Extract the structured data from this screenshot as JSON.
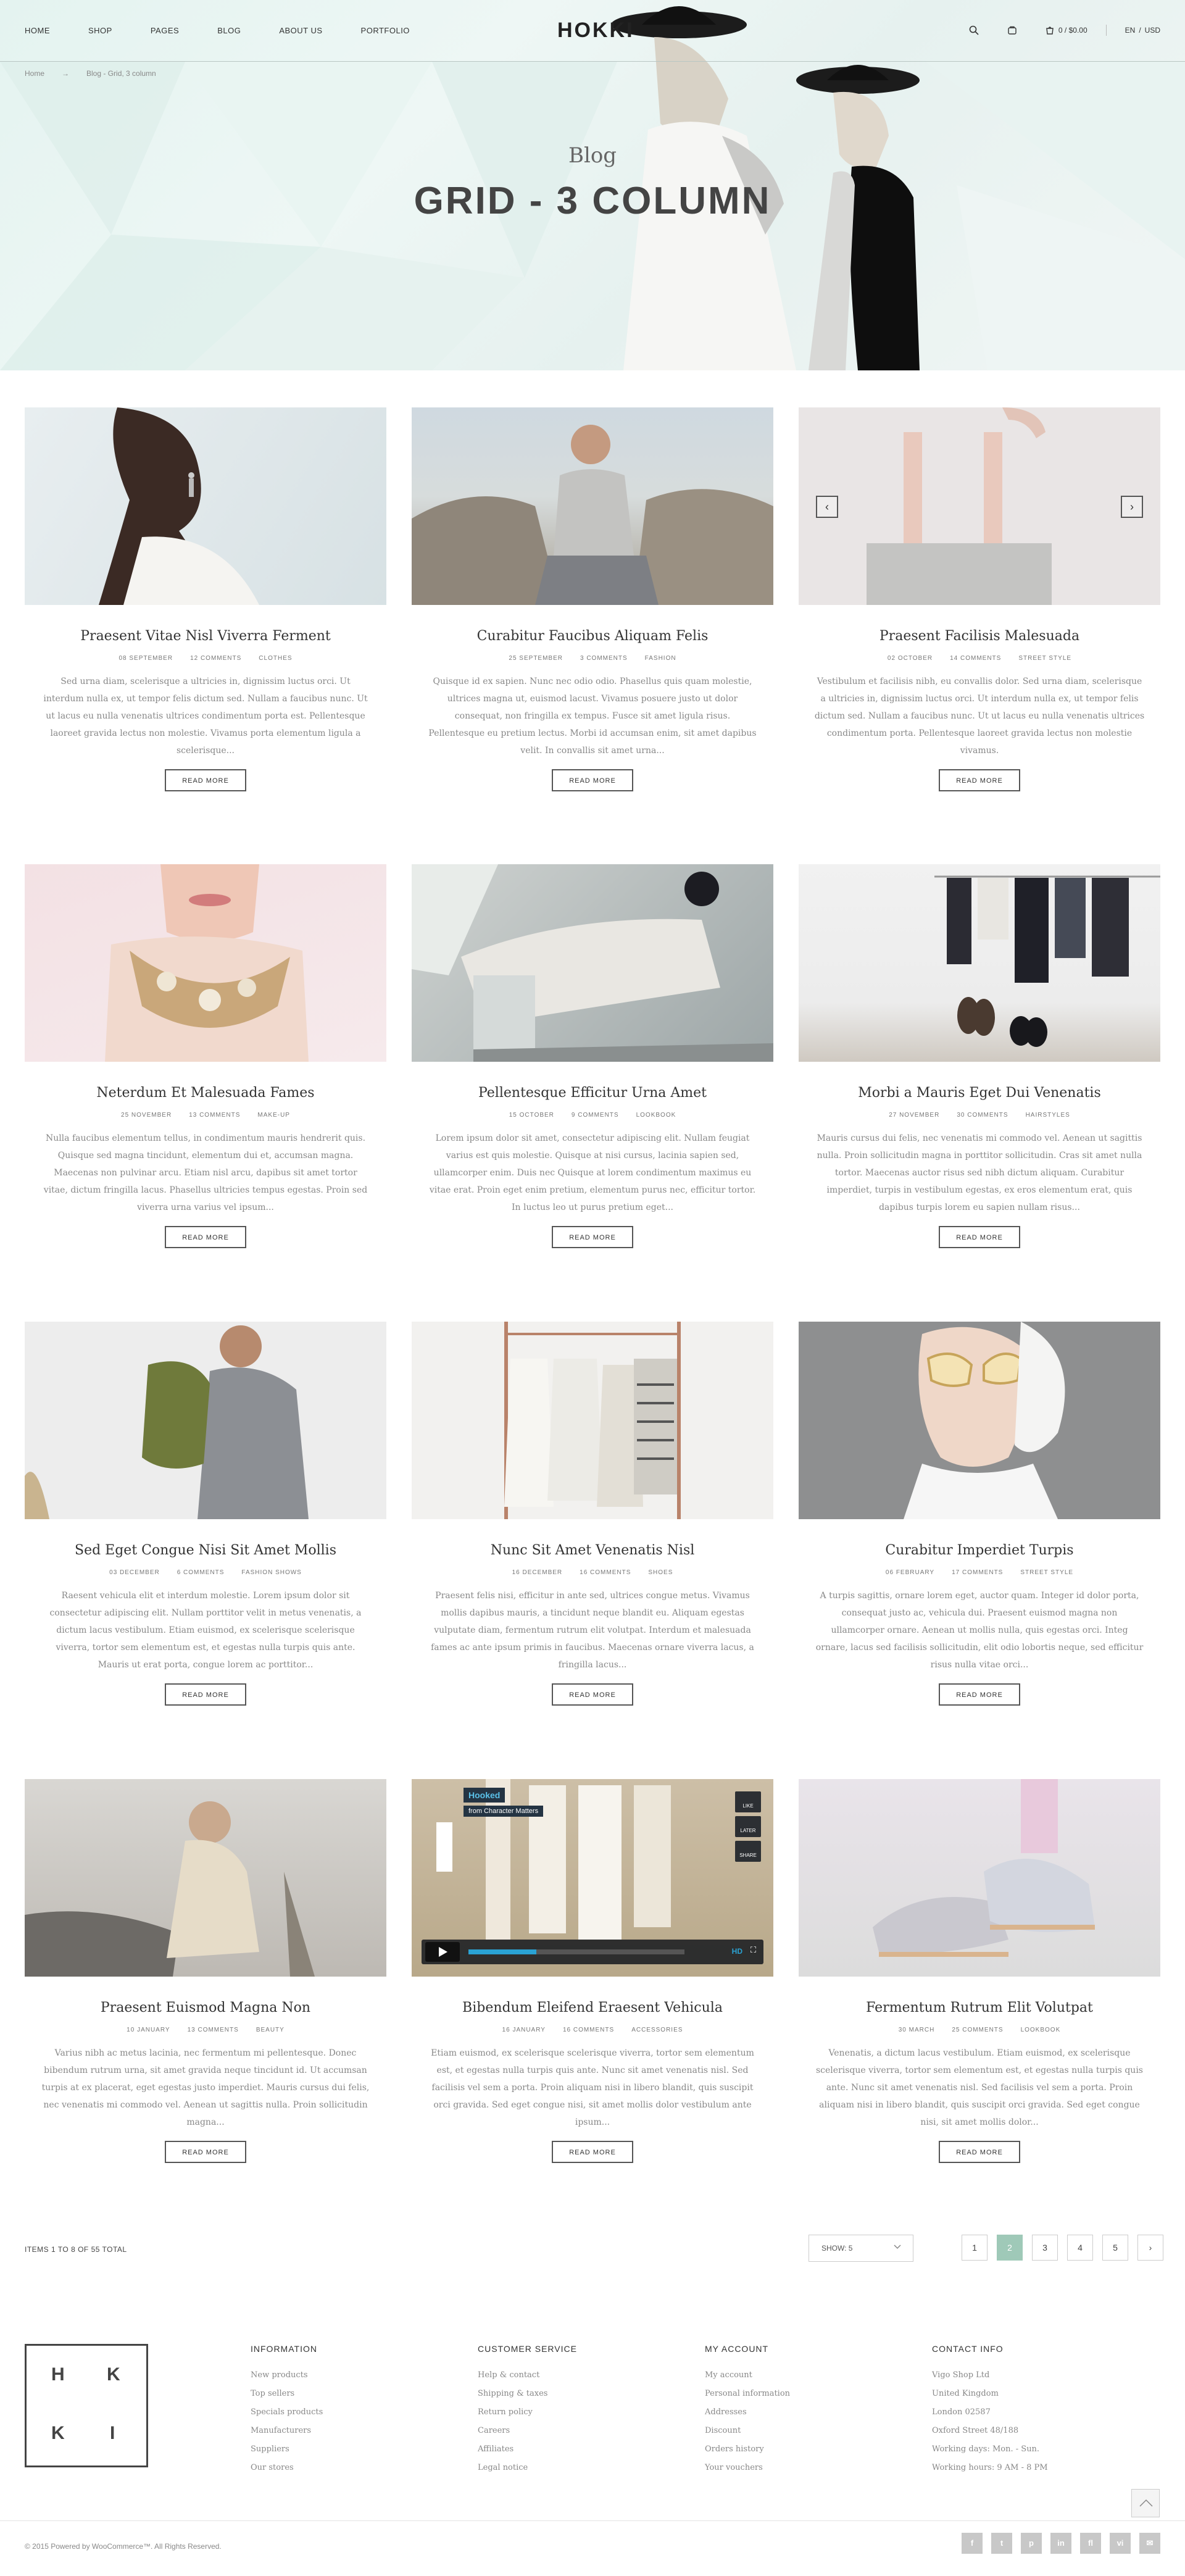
{
  "header": {
    "nav": [
      "HOME",
      "SHOP",
      "PAGES",
      "BLOG",
      "ABOUT US",
      "PORTFOLIO"
    ],
    "logo": "HOKKI",
    "cart_total": "0 / $0.00",
    "lang": "EN",
    "currency": "USD"
  },
  "breadcrumb": {
    "home": "Home",
    "arrow": "→",
    "current": "Blog - Grid, 3 column"
  },
  "hero": {
    "subtitle": "Blog",
    "title": "GRID - 3 COLUMN"
  },
  "posts": [
    {
      "title": "Praesent Vitae Nisl Viverra Ferment",
      "date": "08 SEPTEMBER",
      "comments": "12 COMMENTS",
      "category": "CLOTHES",
      "excerpt": "Sed urna diam, scelerisque a ultricies in, dignissim luctus orci. Ut interdum nulla ex, ut tempor felis dictum sed. Nullam a faucibus nunc. Ut ut lacus eu nulla venenatis ultrices condimentum porta est. Pellentesque laoreet gravida lectus non molestie. Vivamus porta elementum ligula a scelerisque...",
      "button": "READ MORE"
    },
    {
      "title": "Curabitur Faucibus Aliquam Felis",
      "date": "25 SEPTEMBER",
      "comments": "3 COMMENTS",
      "category": "FASHION",
      "excerpt": "Quisque id ex sapien. Nunc nec odio odio. Phasellus quis quam molestie, ultrices magna ut, euismod lacust. Vivamus posuere justo ut dolor consequat, non fringilla ex tempus. Fusce sit amet ligula risus. Pellentesque eu pretium lectus. Morbi id accumsan enim, sit amet dapibus velit. In convallis sit amet urna...",
      "button": "READ MORE"
    },
    {
      "title": "Praesent Facilisis Malesuada",
      "date": "02 OCTOBER",
      "comments": "14 COMMENTS",
      "category": "STREET STYLE",
      "excerpt": "Vestibulum et facilisis nibh, eu convallis dolor. Sed urna diam, scelerisque a ultricies in, dignissim luctus orci. Ut interdum nulla ex, ut tempor felis dictum sed. Nullam a faucibus nunc. Ut ut lacus eu nulla venenatis ultrices condimentum porta. Pellentesque laoreet gravida lectus non molestie vivamus.",
      "button": "READ MORE"
    },
    {
      "title": "Neterdum Et Malesuada Fames",
      "date": "25 NOVEMBER",
      "comments": "13 COMMENTS",
      "category": "MAKE-UP",
      "excerpt": "Nulla faucibus elementum tellus, in condimentum mauris hendrerit quis. Quisque sed magna tincidunt, elementum dui et, accumsan magna. Maecenas non pulvinar arcu. Etiam nisl arcu, dapibus sit amet tortor vitae, dictum fringilla lacus. Phasellus ultricies tempus egestas. Proin sed viverra urna varius vel ipsum...",
      "button": "READ MORE"
    },
    {
      "title": "Pellentesque Efficitur Urna Amet",
      "date": "15 OCTOBER",
      "comments": "9 COMMENTS",
      "category": "LOOKBOOK",
      "excerpt": "Lorem ipsum dolor sit amet, consectetur adipiscing elit. Nullam feugiat varius est quis molestie. Quisque at nisi cursus, lacinia sapien sed, ullamcorper enim. Duis nec Quisque at lorem condimentum maximus eu vitae erat. Proin eget enim pretium, elementum purus nec, efficitur tortor. In luctus leo ut purus pretium eget...",
      "button": "READ MORE"
    },
    {
      "title": "Morbi a Mauris Eget Dui Venenatis",
      "date": "27 NOVEMBER",
      "comments": "30 COMMENTS",
      "category": "HAIRSTYLES",
      "excerpt": "Mauris cursus dui felis, nec venenatis mi commodo vel. Aenean ut sagittis nulla. Proin sollicitudin magna in porttitor sollicitudin. Cras sit amet nulla tortor. Maecenas auctor risus sed nibh dictum aliquam. Curabitur imperdiet, turpis in vestibulum egestas, ex eros elementum erat, quis dapibus turpis lorem eu sapien nullam risus...",
      "button": "READ MORE"
    },
    {
      "title": "Sed Eget Congue Nisi Sit Amet Mollis",
      "date": "03 DECEMBER",
      "comments": "6 COMMENTS",
      "category": "FASHION SHOWS",
      "excerpt": "Raesent vehicula elit et interdum molestie. Lorem ipsum dolor sit consectetur adipiscing elit. Nullam porttitor velit in metus venenatis, a dictum lacus vestibulum. Etiam euismod, ex scelerisque scelerisque viverra, tortor sem elementum est, et egestas nulla turpis quis ante. Mauris ut erat porta, congue lorem ac porttitor...",
      "button": "READ MORE"
    },
    {
      "title": "Nunc Sit Amet Venenatis Nisl",
      "date": "16 DECEMBER",
      "comments": "16 COMMENTS",
      "category": "SHOES",
      "excerpt": "Praesent felis nisi, efficitur in ante sed, ultrices congue metus. Vivamus mollis dapibus mauris, a tincidunt neque blandit eu. Aliquam egestas vulputate diam, fermentum rutrum elit volutpat. Interdum et malesuada fames ac ante ipsum primis in faucibus. Maecenas ornare viverra lacus, a fringilla lacus...",
      "button": "READ MORE"
    },
    {
      "title": "Curabitur Imperdiet Turpis",
      "date": "06 FEBRUARY",
      "comments": "17 COMMENTS",
      "category": "STREET STYLE",
      "excerpt": "A turpis sagittis, ornare lorem eget, auctor quam. Integer id dolor porta, consequat justo ac, vehicula dui. Praesent euismod magna non ullamcorper ornare. Aenean ut mollis nulla, quis egestas orci. Integ ornare, lacus sed facilisis sollicitudin, elit odio lobortis neque, sed efficitur risus nulla vitae orci...",
      "button": "READ MORE"
    },
    {
      "title": "Praesent Euismod Magna Non",
      "date": "10 JANUARY",
      "comments": "13 COMMENTS",
      "category": "BEAUTY",
      "excerpt": "Varius nibh ac metus lacinia, nec fermentum mi pellentesque. Donec bibendum rutrum urna, sit amet gravida neque tincidunt id. Ut accumsan turpis at ex placerat, eget egestas justo imperdiet. Mauris cursus dui felis, nec venenatis mi commodo vel. Aenean ut sagittis nulla. Proin sollicitudin magna...",
      "button": "READ MORE"
    },
    {
      "title": "Bibendum Eleifend Eraesent Vehicula",
      "date": "16 JANUARY",
      "comments": "16 COMMENTS",
      "category": "ACCESSORIES",
      "excerpt": "Etiam euismod, ex scelerisque scelerisque viverra, tortor sem elementum est, et egestas nulla turpis quis ante. Nunc sit amet venenatis nisl. Sed facilisis vel sem a porta. Proin aliquam nisi in libero blandit, quis suscipit orci gravida. Sed eget congue nisi, sit amet mollis dolor vestibulum ante ipsum...",
      "button": "READ MORE"
    },
    {
      "title": "Fermentum Rutrum Elit Volutpat",
      "date": "30 MARCH",
      "comments": "25 COMMENTS",
      "category": "LOOKBOOK",
      "excerpt": "Venenatis, a dictum lacus vestibulum. Etiam euismod, ex scelerisque scelerisque viverra, tortor sem elementum est, et egestas nulla turpis quis ante. Nunc sit amet venenatis nisl. Sed facilisis vel sem a porta. Proin aliquam nisi in libero blandit, quis suscipit orci gravida. Sed eget congue nisi, sit amet mollis dolor...",
      "button": "READ MORE"
    }
  ],
  "video": {
    "title": "Hooked",
    "from": "from Character Matters",
    "like": "LIKE",
    "later": "LATER",
    "share": "SHARE",
    "hd": "HD"
  },
  "listing": {
    "items_total": "ITEMS 1 TO 8 OF 55 TOTAL",
    "show_label": "SHOW: 5",
    "pages": [
      "1",
      "2",
      "3",
      "4",
      "5",
      "›"
    ],
    "active_page": "2"
  },
  "footer": {
    "logo_letters": [
      "H",
      "K",
      "K",
      "I"
    ],
    "columns": [
      {
        "title": "INFORMATION",
        "items": [
          "New products",
          "Top sellers",
          "Specials products",
          "Manufacturers",
          "Suppliers",
          "Our stores"
        ]
      },
      {
        "title": "CUSTOMER SERVICE",
        "items": [
          "Help & contact",
          "Shipping & taxes",
          "Return policy",
          "Careers",
          "Affiliates",
          "Legal notice"
        ]
      },
      {
        "title": "MY ACCOUNT",
        "items": [
          "My account",
          "Personal information",
          "Addresses",
          "Discount",
          "Orders history",
          "Your vouchers"
        ]
      },
      {
        "title": "CONTACT INFO",
        "items": [
          "Vigo Shop Ltd",
          "United Kingdom",
          "London 02587",
          "Oxford Street 48/188",
          "Working days: Mon. - Sun.",
          "Working hours: 9 AM - 8 PM"
        ]
      }
    ],
    "copyright": "© 2015 Powered by WooCommerce™. All Rights Reserved.",
    "social": [
      "f",
      "t",
      "p",
      "in",
      "fl",
      "vi",
      "✉"
    ]
  }
}
